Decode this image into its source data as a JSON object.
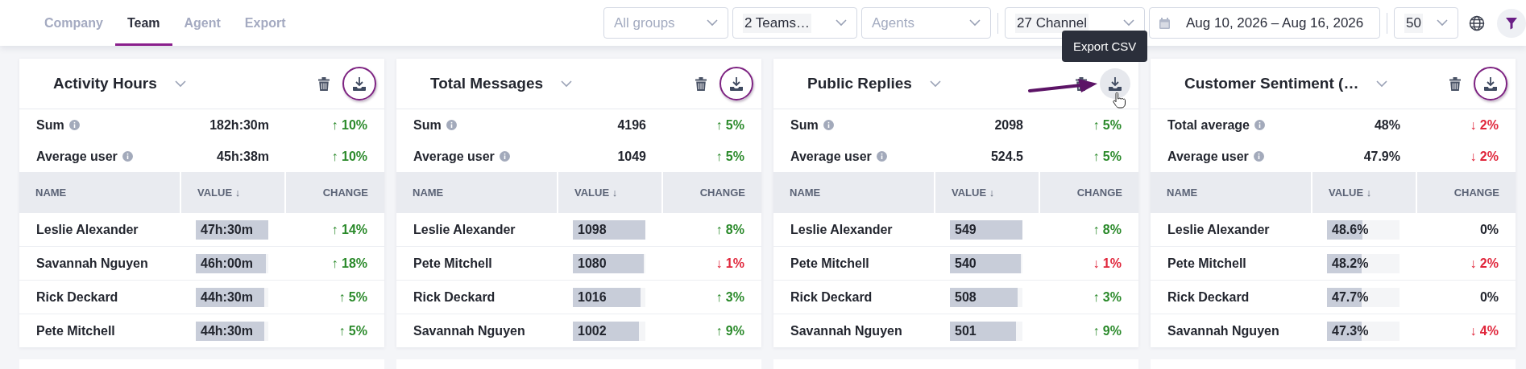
{
  "tabs": [
    {
      "label": "Company",
      "selected": false
    },
    {
      "label": "Team",
      "selected": true
    },
    {
      "label": "Agent",
      "selected": false
    },
    {
      "label": "Export",
      "selected": false
    }
  ],
  "filters": [
    {
      "kind": "select",
      "placeholder": "All groups",
      "group_start": false
    },
    {
      "kind": "select",
      "value": "2 Teams…",
      "group_start": false
    },
    {
      "kind": "select",
      "placeholder": "Agents",
      "group_start": false
    },
    {
      "kind": "select",
      "value": "27 Channel",
      "group_start": true
    },
    {
      "kind": "date",
      "value": "Aug 10, 2026 – Aug 16, 2026",
      "group_start": false
    },
    {
      "kind": "select",
      "value": "50",
      "group_start": true
    }
  ],
  "tooltip": {
    "text": "Export CSV"
  },
  "cards": [
    {
      "title": "Activity Hours",
      "export_circled": true,
      "export_hovered": false,
      "summary": [
        {
          "label": "Sum",
          "value": "182h:30m",
          "change": "↑ 10%",
          "color": "#2b8a2b"
        },
        {
          "label": "Average user",
          "value": "45h:38m",
          "change": "↑ 10%",
          "color": "#2b8a2b"
        }
      ],
      "columns": [
        "NAME",
        "VALUE ↓",
        "CHANGE"
      ],
      "rows": [
        {
          "name": "Leslie Alexander",
          "value": "47h:30m",
          "level": 1,
          "change": "↑ 14%",
          "color": "#2b8a2b"
        },
        {
          "name": "Savannah Nguyen",
          "value": "46h:00m",
          "level": 0.97,
          "change": "↑ 18%",
          "color": "#2b8a2b"
        },
        {
          "name": "Rick Deckard",
          "value": "44h:30m",
          "level": 0.94,
          "change": "↑ 5%",
          "color": "#2b8a2b"
        },
        {
          "name": "Pete Mitchell",
          "value": "44h:30m",
          "level": 0.94,
          "change": "↑ 5%",
          "color": "#2b8a2b"
        }
      ]
    },
    {
      "title": "Total Messages",
      "export_circled": true,
      "export_hovered": false,
      "summary": [
        {
          "label": "Sum",
          "value": "4196",
          "change": "↑ 5%",
          "color": "#2b8a2b"
        },
        {
          "label": "Average user",
          "value": "1049",
          "change": "↑ 5%",
          "color": "#2b8a2b"
        }
      ],
      "columns": [
        "NAME",
        "VALUE ↓",
        "CHANGE"
      ],
      "rows": [
        {
          "name": "Leslie Alexander",
          "value": "1098",
          "level": 1,
          "change": "↑ 8%",
          "color": "#2b8a2b"
        },
        {
          "name": "Pete Mitchell",
          "value": "1080",
          "level": 0.98,
          "change": "↓ 1%",
          "color": "#e0263b"
        },
        {
          "name": "Rick Deckard",
          "value": "1016",
          "level": 0.93,
          "change": "↑ 3%",
          "color": "#2b8a2b"
        },
        {
          "name": "Savannah Nguyen",
          "value": "1002",
          "level": 0.91,
          "change": "↑ 9%",
          "color": "#2b8a2b"
        }
      ]
    },
    {
      "title": "Public Replies",
      "export_circled": false,
      "export_hovered": true,
      "summary": [
        {
          "label": "Sum",
          "value": "2098",
          "change": "↑ 5%",
          "color": "#2b8a2b"
        },
        {
          "label": "Average user",
          "value": "524.5",
          "change": "↑ 5%",
          "color": "#2b8a2b"
        }
      ],
      "columns": [
        "NAME",
        "VALUE ↓",
        "CHANGE"
      ],
      "rows": [
        {
          "name": "Leslie Alexander",
          "value": "549",
          "level": 1,
          "change": "↑ 8%",
          "color": "#2b8a2b"
        },
        {
          "name": "Pete Mitchell",
          "value": "540",
          "level": 0.98,
          "change": "↓ 1%",
          "color": "#e0263b"
        },
        {
          "name": "Rick Deckard",
          "value": "508",
          "level": 0.93,
          "change": "↑ 3%",
          "color": "#2b8a2b"
        },
        {
          "name": "Savannah Nguyen",
          "value": "501",
          "level": 0.91,
          "change": "↑ 9%",
          "color": "#2b8a2b"
        }
      ]
    },
    {
      "title": "Customer Sentiment (…",
      "export_circled": true,
      "export_hovered": false,
      "summary": [
        {
          "label": "Total average",
          "value": "48%",
          "change": "↓ 2%",
          "color": "#e0263b"
        },
        {
          "label": "Average user",
          "value": "47.9%",
          "change": "↓ 2%",
          "color": "#e0263b"
        }
      ],
      "columns": [
        "NAME",
        "VALUE ↓",
        "CHANGE"
      ],
      "rows": [
        {
          "name": "Leslie Alexander",
          "value": "48.6%",
          "level": 0.486,
          "change": "0%",
          "color": "#23262f"
        },
        {
          "name": "Pete Mitchell",
          "value": "48.2%",
          "level": 0.482,
          "change": "↓ 2%",
          "color": "#e0263b"
        },
        {
          "name": "Rick Deckard",
          "value": "47.7%",
          "level": 0.477,
          "change": "0%",
          "color": "#23262f"
        },
        {
          "name": "Savannah Nguyen",
          "value": "47.3%",
          "level": 0.473,
          "change": "↓ 4%",
          "color": "#e0263b"
        }
      ]
    }
  ]
}
